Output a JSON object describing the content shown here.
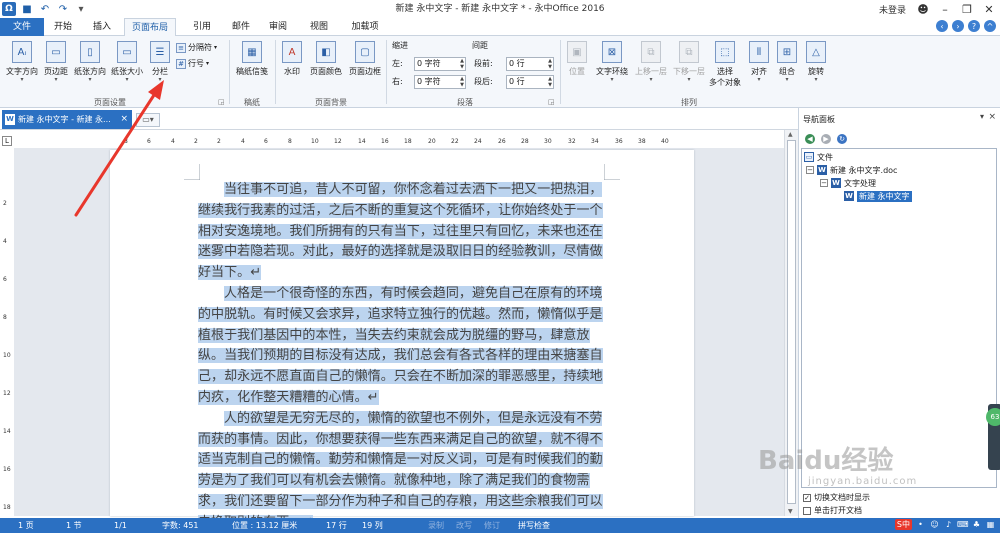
{
  "titlebar": {
    "title": "新建 永中文字 - 新建 永中文字 * - 永中Office 2016",
    "login": "未登录",
    "qat_icons": [
      "app-logo",
      "save-icon",
      "undo-icon",
      "redo-icon",
      "customize-icon"
    ]
  },
  "tabs": {
    "file": "文件",
    "start": "开始",
    "insert": "插入",
    "layout": "页面布局",
    "reference": "引用",
    "mail": "邮件",
    "review": "审阅",
    "view": "视图",
    "addon": "加载项"
  },
  "ribbon": {
    "page_setup": {
      "label": "页面设置",
      "text_direction": "文字方向",
      "margins": "页边距",
      "orientation": "纸张方向",
      "size": "纸张大小",
      "columns": "分栏",
      "breaks": "分隔符",
      "line_numbers": "行号"
    },
    "paper": {
      "label": "稿纸",
      "paper_settings": "稿纸信笺"
    },
    "page_background": {
      "label": "页面背景",
      "watermark": "水印",
      "page_color": "页面颜色",
      "page_border": "页面边框"
    },
    "paragraph": {
      "label": "段落",
      "indent_title": "缩进",
      "indent_left_label": "左:",
      "indent_left_value": "0 字符",
      "indent_right_label": "右:",
      "indent_right_value": "0 字符",
      "spacing_title": "间距",
      "before_label": "段前:",
      "before_value": "0 行",
      "after_label": "段后:",
      "after_value": "0 行"
    },
    "arrange": {
      "label": "排列",
      "position": "位置",
      "wrap_text": "文字环绕",
      "bring_forward": "上移一层",
      "send_backward": "下移一层",
      "select_multiple_line1": "选择",
      "select_multiple_line2": "多个对象",
      "align": "对齐",
      "group": "组合",
      "rotate": "旋转"
    }
  },
  "doc_tab": {
    "name": "新建 永中文字 - 新建 永...",
    "close": "×",
    "new_tab": "▾"
  },
  "ruler": {
    "h_ticks": [
      "8",
      "6",
      "4",
      "2",
      "2",
      "4",
      "6",
      "8",
      "10",
      "12",
      "14",
      "16",
      "18",
      "20",
      "22",
      "24",
      "26",
      "28",
      "30",
      "32",
      "34",
      "36",
      "38",
      "40"
    ],
    "v_ticks": [
      "2",
      "4",
      "6",
      "8",
      "10",
      "12",
      "14",
      "16",
      "18"
    ],
    "corner": "L"
  },
  "document": {
    "paragraphs": [
      "当往事不可追，昔人不可留，你怀念着过去洒下一把又一把热泪，继续我行我素的过活，之后不断的重复这个死循环，让你始终处于一个相对安逸境地。我们所拥有的只有当下，过往里只有回忆，未来也还在迷雾中若隐若现。对此，最好的选择就是汲取旧日的经验教训，尽情做好当下。↵",
      "人格是一个很奇怪的东西，有时候会趋同，避免自己在原有的环境的中脱轨。有时候又会求异，追求特立独行的优越。然而，懒惰似乎是植根于我们基因中的本性，当失去约束就会成为脱缰的野马，肆意放纵。当我们预期的目标没有达成，我们总会有各式各样的理由来搪塞自己，却永远不愿直面自己的懒惰。只会在不断加深的罪恶感里，持续地内疚，化作整天糟糟的心情。↵",
      "人的欲望是无穷无尽的，懒惰的欲望也不例外，但是永远没有不劳而获的事情。因此，你想要获得一些东西来满足自己的欲望，就不得不适当克制自己的懒惰。勤劳和懒惰是一对反义词，可是有时候我们的勤劳是为了我们可以有机会去懒惰。就像种地，除了满足我们的食物需求，我们还要留下一部分作为种子和自己的存粮，用这些余粮我们可以去换取别的东西。↵"
    ],
    "end_mark": "↵"
  },
  "nav_panel": {
    "title": "导航面板",
    "pin": "▾",
    "close": "×",
    "tree": {
      "root": "文件",
      "doc": "新建 永中文字.doc",
      "folder": "文字处理",
      "item": "新建 永中文字"
    },
    "option1": "切换文档时显示",
    "option2": "单击打开文档",
    "badge": "63"
  },
  "statusbar": {
    "page": "1 页",
    "section": "1 节",
    "page_of": "1/1",
    "word_count": "字数: 451",
    "position": "位置 : 13.12 厘米",
    "line": "17 行",
    "column": "19 列",
    "record": "录制",
    "overwrite": "改写",
    "revise": "修订",
    "spellcheck": "拼写检查",
    "ime": "S中"
  },
  "watermark": {
    "text": "Baidu经验",
    "sub": "jingyan.baidu.com"
  },
  "colors": {
    "accent": "#2b70c2",
    "selection": "#bcd4ef",
    "annotation_arrow": "#e8372c"
  }
}
